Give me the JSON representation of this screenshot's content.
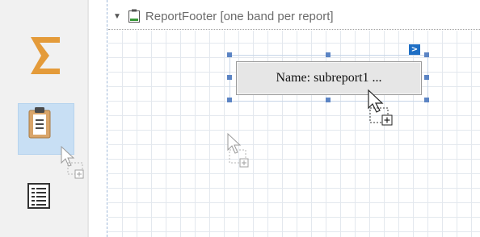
{
  "toolbox": {
    "items": [
      {
        "name": "summary",
        "icon": "sigma-icon"
      },
      {
        "name": "subreport",
        "icon": "clipboard-icon",
        "selected": true
      },
      {
        "name": "table-of-contents",
        "icon": "table-of-contents-icon"
      }
    ]
  },
  "band": {
    "title": "ReportFooter [one band per report]",
    "expand_icon": "collapse-arrow-icon",
    "band_icon": "report-footer-icon"
  },
  "subreport": {
    "label": "Name: subreport1 ...",
    "smart_tag": ">",
    "smart_tag_icon": "smart-tag-icon"
  },
  "colors": {
    "accent": "#1f6fc5",
    "handle": "#5b84c4",
    "selected_tool_bg": "#c8dff4",
    "sigma_orange": "#e49b3a",
    "clipboard_tan": "#d9a56a"
  }
}
